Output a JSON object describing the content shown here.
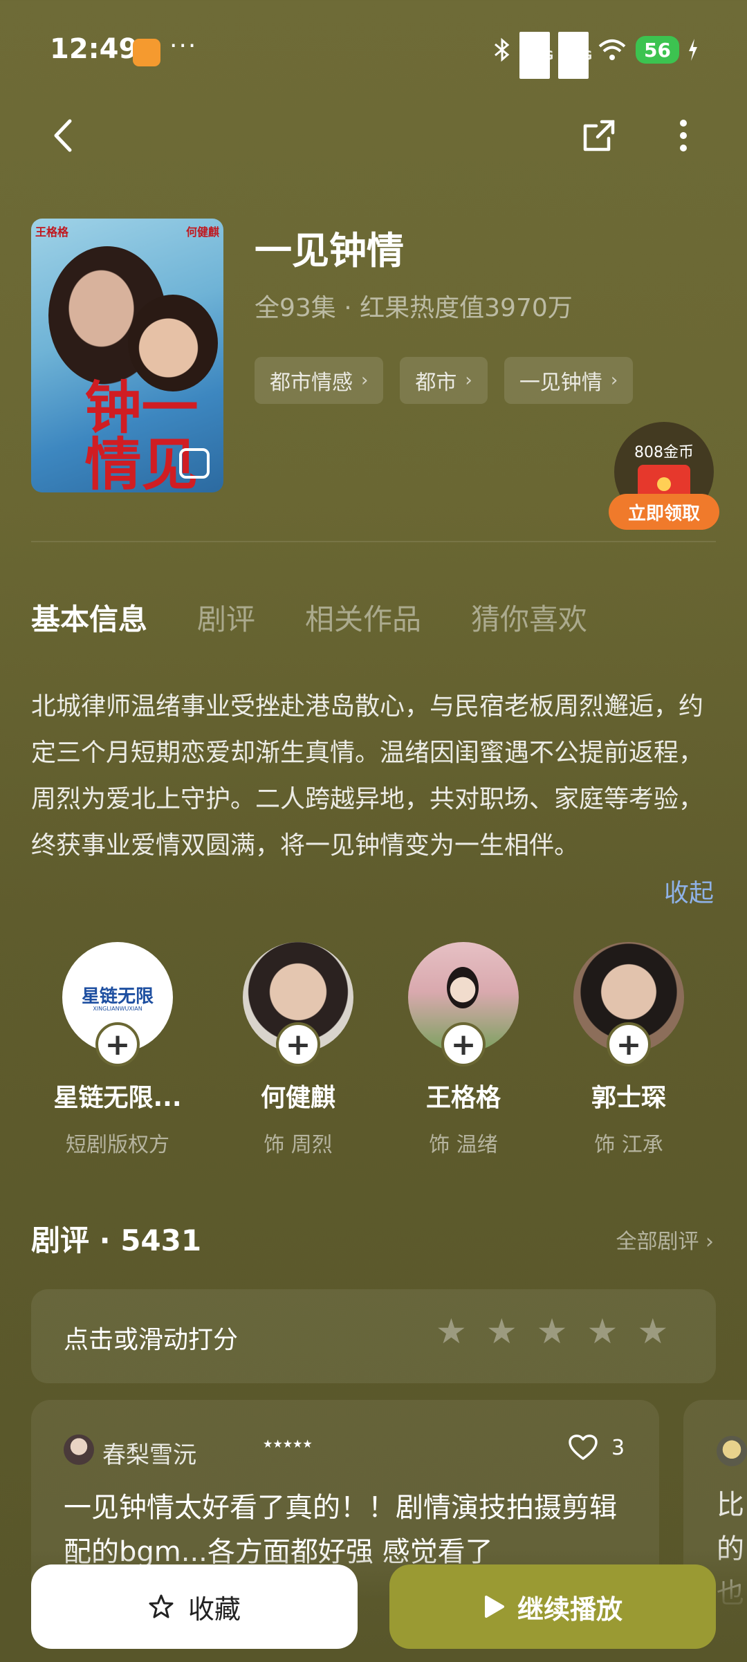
{
  "status_bar": {
    "time": "12:49",
    "dots": "···",
    "network_1": "5G",
    "network_2": "5G",
    "battery": "56"
  },
  "header": {
    "back_icon": "back-arrow-icon",
    "share_icon": "share-icon",
    "more_icon": "more-vertical-icon"
  },
  "show": {
    "title": "一见钟情",
    "meta": "全93集 · 红果热度值3970万",
    "poster": {
      "left_name": "王格格",
      "right_name": "何健麒",
      "title_mark": "一见钟情"
    },
    "tags": [
      "都市情感",
      "都市",
      "一见钟情"
    ]
  },
  "coin_promo": {
    "amount": "808金币",
    "button": "立即领取"
  },
  "tabs": [
    "基本信息",
    "剧评",
    "相关作品",
    "猜你喜欢"
  ],
  "synopsis": "北城律师温绪事业受挫赴港岛散心，与民宿老板周烈邂逅，约定三个月短期恋爱却渐生真情。温绪因闺蜜遇不公提前返程，周烈为爱北上守护。二人跨越异地，共对职场、家庭等考验，终获事业爱情双圆满，将一见钟情变为一生相伴。",
  "collapse_label": "收起",
  "cast": [
    {
      "name": "星链无限...",
      "role": "短剧版权方",
      "logo_text": "星链无限",
      "logo_sub": "XINGLIANWUXIAN"
    },
    {
      "name": "何健麒",
      "role": "饰 周烈"
    },
    {
      "name": "王格格",
      "role": "饰 温绪"
    },
    {
      "name": "郭士琛",
      "role": "饰 江承"
    }
  ],
  "reviews": {
    "heading": "剧评 · 5431",
    "all_label": "全部剧评",
    "rate_prompt": "点击或滑动打分",
    "rating_stars": 5,
    "items": [
      {
        "user": "春梨雪沅",
        "stars": "★★★★★",
        "likes": "3",
        "text": "一见钟情太好看了真的！！剧情演技拍摄剪辑配的bgm...各方面都好强 感觉看了"
      }
    ],
    "next_card_text": "比的也"
  },
  "bottom_bar": {
    "favorite_label": "收藏",
    "play_label": "继续播放"
  },
  "colors": {
    "background": "#6a6733",
    "accent": "#9a9a33",
    "link": "#8fb2e8",
    "coin_button": "#f07a2b"
  }
}
